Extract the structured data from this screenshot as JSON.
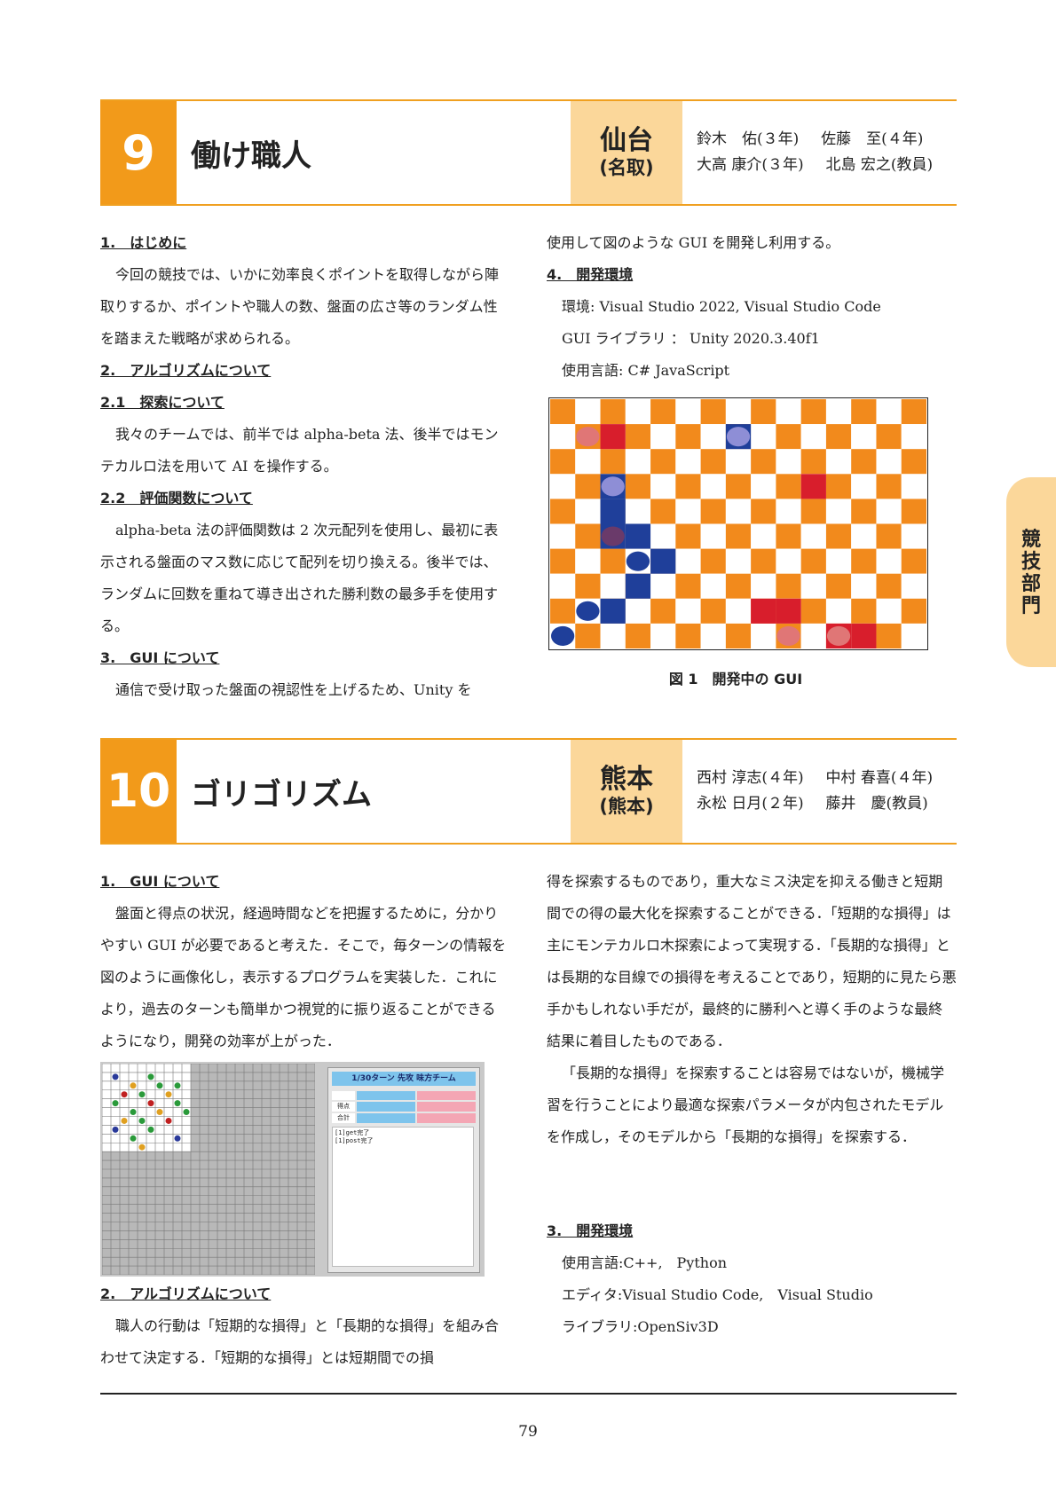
{
  "colors": {
    "accent": "#f29a1a",
    "accent_light": "#fbd79a",
    "board_orange": "#f28a1c",
    "red": "#d81e2c",
    "blue": "#1f3f9a",
    "pink": "#e07676",
    "lavender": "#8e8ed6"
  },
  "side_tab": {
    "label": "競技部門"
  },
  "article9": {
    "number": "9",
    "title": "働け職人",
    "city": "仙台",
    "campus": "(名取)",
    "members": [
      {
        "name": "鈴木　佑",
        "role": "(３年)"
      },
      {
        "name": "佐藤　至",
        "role": "(４年)"
      },
      {
        "name": "大高 康介",
        "role": "(３年)"
      },
      {
        "name": "北島 宏之",
        "role": "(教員)"
      }
    ],
    "left": [
      {
        "type": "heading",
        "text": "1.　はじめに"
      },
      {
        "type": "para",
        "text": "今回の競技では、いかに効率良くポイントを取得しながら陣取りするか、ポイントや職人の数、盤面の広さ等のランダム性を踏まえた戦略が求められる。"
      },
      {
        "type": "heading",
        "text": "2.　アルゴリズムについて"
      },
      {
        "type": "heading",
        "text": "2.1　探索について"
      },
      {
        "type": "para",
        "text": "我々のチームでは、前半では alpha-beta 法、後半ではモンテカルロ法を用いて AI を操作する。"
      },
      {
        "type": "heading",
        "text": "2.2　評価関数について"
      },
      {
        "type": "para",
        "text": "alpha-beta 法の評価関数は 2 次元配列を使用し、最初に表示される盤面のマス数に応じて配列を切り換える。後半では、ランダムに回数を重ねて導き出された勝利数の最多手を使用する。"
      },
      {
        "type": "heading",
        "text": "3.　GUI について"
      },
      {
        "type": "para",
        "text": "通信で受け取った盤面の視認性を上げるため、Unity を"
      }
    ],
    "right_top": "使用して図のような GUI を開発し利用する。",
    "env_heading": "4.　開発環境",
    "env": [
      "環境: Visual Studio 2022, Visual Studio Code",
      "GUI ライブラリ ： Unity 2020.3.40f1",
      "使用言語: C# JavaScript"
    ],
    "figure_caption": "図 1　開発中の GUI"
  },
  "article10": {
    "number": "10",
    "title": "ゴリゴリズム",
    "city": "熊本",
    "campus": "(熊本)",
    "members": [
      {
        "name": "西村 淳志",
        "role": "(４年)"
      },
      {
        "name": "中村 春喜",
        "role": "(４年)"
      },
      {
        "name": "永松 日月",
        "role": "(２年)"
      },
      {
        "name": "藤井　慶",
        "role": "(教員)"
      }
    ],
    "gui_heading": "1.　GUI について",
    "gui_para": "盤面と得点の状況，経過時間などを把握するために，分かりやすい GUI が必要であると考えた．そこで，毎ターンの情報を図のように画像化し，表示するプログラムを実装した．これにより，過去のターンも簡単かつ視覚的に振り返ることができるようになり，開発の効率が上がった．",
    "panel_title": "1/30ターン 先攻 味方チーム",
    "panel_row1": "得点",
    "panel_row2": "合計",
    "panel_log1": "[1]get完了",
    "panel_log2": "[1]post完了",
    "algo_heading": "2.　アルゴリズムについて",
    "algo_para": "職人の行動は「短期的な損得」と「長期的な損得」を組み合わせて決定する．「短期的な損得」とは短期間での損",
    "right_para1": "得を探索するものであり，重大なミス決定を抑える働きと短期間での得の最大化を探索することができる．「短期的な損得」は主にモンテカルロ木探索によって実現する．「長期的な損得」とは長期的な目線での損得を考えることであり，短期的に見たら悪手かもしれない手だが，最終的に勝利へと導く手のような最終結果に着目したものである．",
    "right_para2": "「長期的な損得」を探索することは容易ではないが，機械学習を行うことにより最適な探索パラメータが内包されたモデルを作成し，そのモデルから「長期的な損得」を探索する．",
    "env_heading": "3.　開発環境",
    "env": [
      "使用言語:C++,　Python",
      "エディタ:Visual Studio Code,　Visual Studio",
      "ライブラリ:OpenSiv3D"
    ]
  },
  "page_number": "79"
}
